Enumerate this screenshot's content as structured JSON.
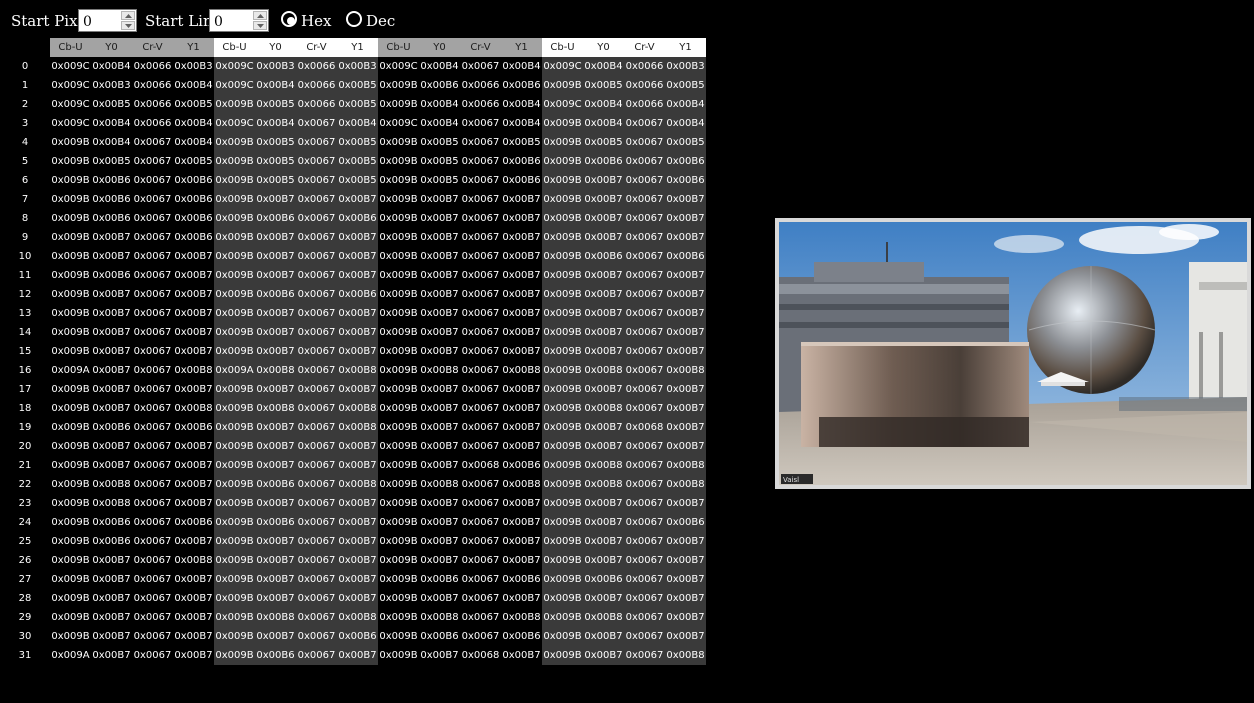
{
  "controls": {
    "start_pixel_label": "Start Pixel",
    "start_pixel_value": "0",
    "start_line_label": "Start Line",
    "start_line_value": "0",
    "radio_hex_label": "Hex",
    "radio_dec_label": "Dec",
    "selected_format": "Hex"
  },
  "table": {
    "columns": [
      "Cb-U",
      "Y0",
      "Cr-V",
      "Y1",
      "Cb-U",
      "Y0",
      "Cr-V",
      "Y1",
      "Cb-U",
      "Y0",
      "Cr-V",
      "Y1",
      "Cb-U",
      "Y0",
      "Cr-V",
      "Y1"
    ],
    "rows": [
      [
        "0",
        "0x009C",
        "0x00B4",
        "0x0066",
        "0x00B3",
        "0x009C",
        "0x00B3",
        "0x0066",
        "0x00B3",
        "0x009C",
        "0x00B4",
        "0x0067",
        "0x00B4",
        "0x009C",
        "0x00B4",
        "0x0066",
        "0x00B3"
      ],
      [
        "1",
        "0x009C",
        "0x00B3",
        "0x0066",
        "0x00B4",
        "0x009C",
        "0x00B4",
        "0x0066",
        "0x00B5",
        "0x009B",
        "0x00B6",
        "0x0066",
        "0x00B6",
        "0x009B",
        "0x00B5",
        "0x0066",
        "0x00B5"
      ],
      [
        "2",
        "0x009C",
        "0x00B5",
        "0x0066",
        "0x00B5",
        "0x009B",
        "0x00B5",
        "0x0066",
        "0x00B5",
        "0x009B",
        "0x00B4",
        "0x0066",
        "0x00B4",
        "0x009C",
        "0x00B4",
        "0x0066",
        "0x00B4"
      ],
      [
        "3",
        "0x009C",
        "0x00B4",
        "0x0066",
        "0x00B4",
        "0x009C",
        "0x00B4",
        "0x0067",
        "0x00B4",
        "0x009C",
        "0x00B4",
        "0x0067",
        "0x00B4",
        "0x009B",
        "0x00B4",
        "0x0067",
        "0x00B4"
      ],
      [
        "4",
        "0x009B",
        "0x00B4",
        "0x0067",
        "0x00B4",
        "0x009B",
        "0x00B5",
        "0x0067",
        "0x00B5",
        "0x009B",
        "0x00B5",
        "0x0067",
        "0x00B5",
        "0x009B",
        "0x00B5",
        "0x0067",
        "0x00B5"
      ],
      [
        "5",
        "0x009B",
        "0x00B5",
        "0x0067",
        "0x00B5",
        "0x009B",
        "0x00B5",
        "0x0067",
        "0x00B5",
        "0x009B",
        "0x00B5",
        "0x0067",
        "0x00B6",
        "0x009B",
        "0x00B6",
        "0x0067",
        "0x00B6"
      ],
      [
        "6",
        "0x009B",
        "0x00B6",
        "0x0067",
        "0x00B6",
        "0x009B",
        "0x00B5",
        "0x0067",
        "0x00B5",
        "0x009B",
        "0x00B5",
        "0x0067",
        "0x00B6",
        "0x009B",
        "0x00B7",
        "0x0067",
        "0x00B6"
      ],
      [
        "7",
        "0x009B",
        "0x00B6",
        "0x0067",
        "0x00B6",
        "0x009B",
        "0x00B7",
        "0x0067",
        "0x00B7",
        "0x009B",
        "0x00B7",
        "0x0067",
        "0x00B7",
        "0x009B",
        "0x00B7",
        "0x0067",
        "0x00B7"
      ],
      [
        "8",
        "0x009B",
        "0x00B6",
        "0x0067",
        "0x00B6",
        "0x009B",
        "0x00B6",
        "0x0067",
        "0x00B6",
        "0x009B",
        "0x00B7",
        "0x0067",
        "0x00B7",
        "0x009B",
        "0x00B7",
        "0x0067",
        "0x00B7"
      ],
      [
        "9",
        "0x009B",
        "0x00B7",
        "0x0067",
        "0x00B6",
        "0x009B",
        "0x00B7",
        "0x0067",
        "0x00B7",
        "0x009B",
        "0x00B7",
        "0x0067",
        "0x00B7",
        "0x009B",
        "0x00B7",
        "0x0067",
        "0x00B7"
      ],
      [
        "10",
        "0x009B",
        "0x00B7",
        "0x0067",
        "0x00B7",
        "0x009B",
        "0x00B7",
        "0x0067",
        "0x00B7",
        "0x009B",
        "0x00B7",
        "0x0067",
        "0x00B7",
        "0x009B",
        "0x00B6",
        "0x0067",
        "0x00B6"
      ],
      [
        "11",
        "0x009B",
        "0x00B6",
        "0x0067",
        "0x00B7",
        "0x009B",
        "0x00B7",
        "0x0067",
        "0x00B7",
        "0x009B",
        "0x00B7",
        "0x0067",
        "0x00B7",
        "0x009B",
        "0x00B7",
        "0x0067",
        "0x00B7"
      ],
      [
        "12",
        "0x009B",
        "0x00B7",
        "0x0067",
        "0x00B7",
        "0x009B",
        "0x00B6",
        "0x0067",
        "0x00B6",
        "0x009B",
        "0x00B7",
        "0x0067",
        "0x00B7",
        "0x009B",
        "0x00B7",
        "0x0067",
        "0x00B7"
      ],
      [
        "13",
        "0x009B",
        "0x00B7",
        "0x0067",
        "0x00B7",
        "0x009B",
        "0x00B7",
        "0x0067",
        "0x00B7",
        "0x009B",
        "0x00B7",
        "0x0067",
        "0x00B7",
        "0x009B",
        "0x00B7",
        "0x0067",
        "0x00B7"
      ],
      [
        "14",
        "0x009B",
        "0x00B7",
        "0x0067",
        "0x00B7",
        "0x009B",
        "0x00B7",
        "0x0067",
        "0x00B7",
        "0x009B",
        "0x00B7",
        "0x0067",
        "0x00B7",
        "0x009B",
        "0x00B7",
        "0x0067",
        "0x00B7"
      ],
      [
        "15",
        "0x009B",
        "0x00B7",
        "0x0067",
        "0x00B7",
        "0x009B",
        "0x00B7",
        "0x0067",
        "0x00B7",
        "0x009B",
        "0x00B7",
        "0x0067",
        "0x00B7",
        "0x009B",
        "0x00B7",
        "0x0067",
        "0x00B7"
      ],
      [
        "16",
        "0x009A",
        "0x00B7",
        "0x0067",
        "0x00B8",
        "0x009A",
        "0x00B8",
        "0x0067",
        "0x00B8",
        "0x009B",
        "0x00B8",
        "0x0067",
        "0x00B8",
        "0x009B",
        "0x00B8",
        "0x0067",
        "0x00B8"
      ],
      [
        "17",
        "0x009B",
        "0x00B7",
        "0x0067",
        "0x00B7",
        "0x009B",
        "0x00B7",
        "0x0067",
        "0x00B7",
        "0x009B",
        "0x00B7",
        "0x0067",
        "0x00B7",
        "0x009B",
        "0x00B7",
        "0x0067",
        "0x00B7"
      ],
      [
        "18",
        "0x009B",
        "0x00B7",
        "0x0067",
        "0x00B8",
        "0x009B",
        "0x00B8",
        "0x0067",
        "0x00B8",
        "0x009B",
        "0x00B7",
        "0x0067",
        "0x00B7",
        "0x009B",
        "0x00B8",
        "0x0067",
        "0x00B7"
      ],
      [
        "19",
        "0x009B",
        "0x00B6",
        "0x0067",
        "0x00B6",
        "0x009B",
        "0x00B7",
        "0x0067",
        "0x00B8",
        "0x009B",
        "0x00B7",
        "0x0067",
        "0x00B7",
        "0x009B",
        "0x00B7",
        "0x0068",
        "0x00B7"
      ],
      [
        "20",
        "0x009B",
        "0x00B7",
        "0x0067",
        "0x00B7",
        "0x009B",
        "0x00B7",
        "0x0067",
        "0x00B7",
        "0x009B",
        "0x00B7",
        "0x0067",
        "0x00B7",
        "0x009B",
        "0x00B7",
        "0x0067",
        "0x00B7"
      ],
      [
        "21",
        "0x009B",
        "0x00B7",
        "0x0067",
        "0x00B7",
        "0x009B",
        "0x00B7",
        "0x0067",
        "0x00B7",
        "0x009B",
        "0x00B7",
        "0x0068",
        "0x00B6",
        "0x009B",
        "0x00B8",
        "0x0067",
        "0x00B8"
      ],
      [
        "22",
        "0x009B",
        "0x00B8",
        "0x0067",
        "0x00B7",
        "0x009B",
        "0x00B6",
        "0x0067",
        "0x00B8",
        "0x009B",
        "0x00B8",
        "0x0067",
        "0x00B8",
        "0x009B",
        "0x00B8",
        "0x0067",
        "0x00B8"
      ],
      [
        "23",
        "0x009B",
        "0x00B8",
        "0x0067",
        "0x00B7",
        "0x009B",
        "0x00B7",
        "0x0067",
        "0x00B7",
        "0x009B",
        "0x00B7",
        "0x0067",
        "0x00B7",
        "0x009B",
        "0x00B7",
        "0x0067",
        "0x00B7"
      ],
      [
        "24",
        "0x009B",
        "0x00B6",
        "0x0067",
        "0x00B6",
        "0x009B",
        "0x00B6",
        "0x0067",
        "0x00B7",
        "0x009B",
        "0x00B7",
        "0x0067",
        "0x00B7",
        "0x009B",
        "0x00B7",
        "0x0067",
        "0x00B6"
      ],
      [
        "25",
        "0x009B",
        "0x00B6",
        "0x0067",
        "0x00B7",
        "0x009B",
        "0x00B7",
        "0x0067",
        "0x00B7",
        "0x009B",
        "0x00B7",
        "0x0067",
        "0x00B7",
        "0x009B",
        "0x00B7",
        "0x0067",
        "0x00B7"
      ],
      [
        "26",
        "0x009B",
        "0x00B7",
        "0x0067",
        "0x00B8",
        "0x009B",
        "0x00B7",
        "0x0067",
        "0x00B7",
        "0x009B",
        "0x00B7",
        "0x0067",
        "0x00B7",
        "0x009B",
        "0x00B7",
        "0x0067",
        "0x00B7"
      ],
      [
        "27",
        "0x009B",
        "0x00B7",
        "0x0067",
        "0x00B7",
        "0x009B",
        "0x00B7",
        "0x0067",
        "0x00B7",
        "0x009B",
        "0x00B6",
        "0x0067",
        "0x00B6",
        "0x009B",
        "0x00B6",
        "0x0067",
        "0x00B7"
      ],
      [
        "28",
        "0x009B",
        "0x00B7",
        "0x0067",
        "0x00B7",
        "0x009B",
        "0x00B7",
        "0x0067",
        "0x00B7",
        "0x009B",
        "0x00B7",
        "0x0067",
        "0x00B7",
        "0x009B",
        "0x00B7",
        "0x0067",
        "0x00B7"
      ],
      [
        "29",
        "0x009B",
        "0x00B7",
        "0x0067",
        "0x00B7",
        "0x009B",
        "0x00B8",
        "0x0067",
        "0x00B8",
        "0x009B",
        "0x00B8",
        "0x0067",
        "0x00B8",
        "0x009B",
        "0x00B8",
        "0x0067",
        "0x00B7"
      ],
      [
        "30",
        "0x009B",
        "0x00B7",
        "0x0067",
        "0x00B7",
        "0x009B",
        "0x00B7",
        "0x0067",
        "0x00B6",
        "0x009B",
        "0x00B6",
        "0x0067",
        "0x00B6",
        "0x009B",
        "0x00B7",
        "0x0067",
        "0x00B7"
      ],
      [
        "31",
        "0x009A",
        "0x00B7",
        "0x0067",
        "0x00B7",
        "0x009B",
        "0x00B6",
        "0x0067",
        "0x00B7",
        "0x009B",
        "0x00B7",
        "0x0068",
        "0x00B7",
        "0x009B",
        "0x00B7",
        "0x0067",
        "0x00B8"
      ]
    ]
  },
  "preview": {
    "watermark": "Vaisl"
  },
  "colors": {
    "background": "#000000",
    "group_dark": "#000000",
    "group_light": "#3a3a3a",
    "header_dark": "#a3a3a3",
    "header_light": "#ffffff",
    "text": "#ffffff"
  }
}
